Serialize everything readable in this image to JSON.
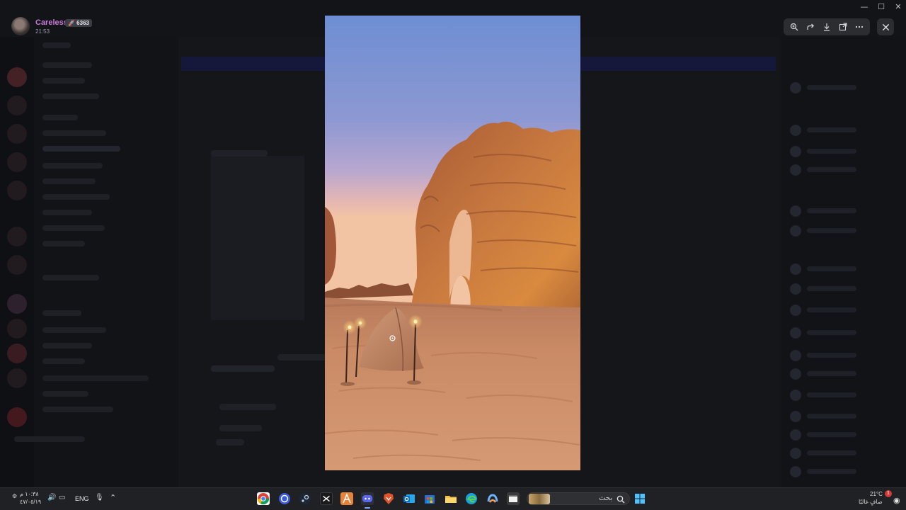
{
  "viewer": {
    "author_name": "Careless",
    "author_badge": "🚀 6363",
    "timestamp": "21:53",
    "toolbar": [
      {
        "name": "zoom-icon"
      },
      {
        "name": "forward-icon"
      },
      {
        "name": "download-icon"
      },
      {
        "name": "open-external-icon"
      },
      {
        "name": "more-icon"
      }
    ],
    "image_subject": "desert rock arch with tent and torches at dusk"
  },
  "taskbar": {
    "time": "١٠:٣٨ م",
    "date": "٤٧/٠٥/١٩",
    "language": "ENG",
    "search_placeholder": "بحث",
    "temperature": "21°C",
    "weather": "صافٍ غالبًا",
    "notification_count": "1",
    "apps": [
      {
        "name": "chrome-icon",
        "color": "#db4437"
      },
      {
        "name": "obs-icon",
        "color": "#3b5bdb"
      },
      {
        "name": "steam-icon",
        "color": "#1b2838"
      },
      {
        "name": "capcut-icon",
        "color": "#1a1a1a"
      },
      {
        "name": "app-a-icon",
        "color": "#e8833a"
      },
      {
        "name": "discord-icon",
        "color": "#5865f2"
      },
      {
        "name": "brave-icon",
        "color": "#e0532b"
      },
      {
        "name": "outlook-icon",
        "color": "#0f6cbd"
      },
      {
        "name": "store-icon",
        "color": "#2b6cd4"
      },
      {
        "name": "explorer-icon",
        "color": "#f3c14b"
      },
      {
        "name": "edge-icon",
        "color": "#1aa0d8"
      },
      {
        "name": "copilot-icon",
        "color": "#6bb3ff"
      },
      {
        "name": "terminal-icon",
        "color": "#3a3a3a"
      }
    ]
  },
  "window": {
    "minimize": "—",
    "maximize": "☐",
    "close": "✕"
  }
}
